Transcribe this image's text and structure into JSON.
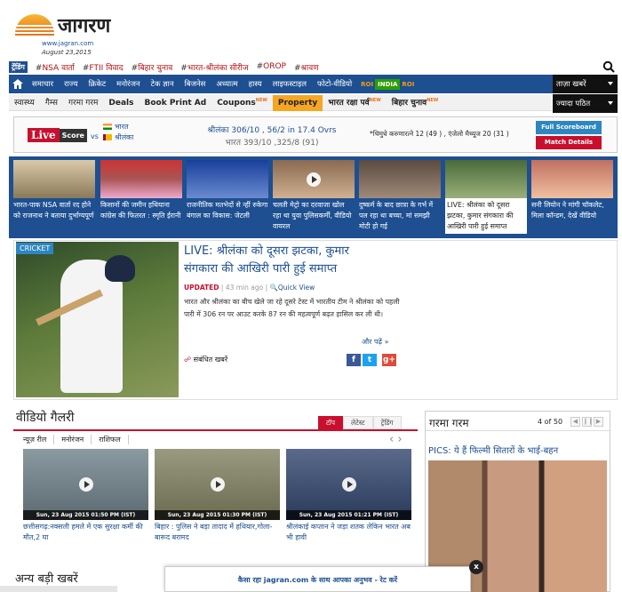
{
  "header": {
    "logo_text": "जागरण",
    "site_url": "www.jagran.com",
    "date": "August 23,2015"
  },
  "trending": {
    "tag": "ट्रेंडिंग",
    "items": [
      "NSA वार्ता",
      "FTII विवाद",
      "बिहार चुनाव",
      "भारत-श्रीलंका सीरीज",
      "OROP",
      "श्रावण"
    ]
  },
  "mainnav": {
    "items": [
      "समाचार",
      "राज्य",
      "क्रिकेट",
      "मनोरंजन",
      "टेक ज्ञान",
      "बिजनेस",
      "अध्यात्म",
      "हास्य",
      "लाइफस्टाइल",
      "फोटो-वीडियो"
    ],
    "roi": [
      "ROI",
      "INDIA",
      "ROI"
    ],
    "dd1": "ताज़ा खबरें",
    "dd2": "ज्यादा पठित"
  },
  "subnav": {
    "items": [
      "स्वास्थ्य",
      "गैम्स",
      "गरमा गरम",
      "Deals",
      "Book Print Ad",
      "Coupons",
      "Property",
      "भारत रक्षा पर्व",
      "बिहार चुनाव"
    ],
    "new_label": "NEW"
  },
  "score": {
    "live": "Live",
    "score_label": "Score",
    "vs": "vs",
    "team1": "भारत",
    "team2": "श्रीलंका",
    "line1": "श्रीलंका 306/10 , 56/2 in 17.4 Ovrs",
    "line2": "भारत 393/10 ,325/8 (91)",
    "batsmen": "*थिमुधे करुणारत्ने 12 (49 ) ,  एंजेलो मैथ्यूज 20 (31 )",
    "full_scoreboard": "Full Scoreboard",
    "match_details": "Match Details"
  },
  "strip": [
    {
      "caption": "भारत-पाक NSA वार्ता रद होने को राजनाथ ने बताया दुर्भाग्यपूर्ण",
      "video": false
    },
    {
      "caption": "किसानों की जमीन हथियाना कांग्रेस की फितरत : स्मृति ईरानी",
      "video": false
    },
    {
      "caption": "राजनीतिक मतभेदों से न्हीं रुकेगा बंगाल का विकास: जेटली",
      "video": false
    },
    {
      "caption": "चलती मेट्रो का दरवाजा खोल रहा था युवा पुलिसकर्मी, वीडियो वायरल",
      "video": true
    },
    {
      "caption": "दुष्कर्म के बाद छात्रा के गर्भ में पल रहा था बच्चा, मां समझी मोटी हो गई",
      "video": false
    },
    {
      "caption": "LIVE: श्रीलंका को दूसरा झटका, कुमार संगकारा की आखिरी पारी हुई समाप्त",
      "video": false
    },
    {
      "caption": "सनी लियोन ने मांगी चॉकलेट, मिला कॉन्डम, देखें वीडियो",
      "video": false
    }
  ],
  "featured": {
    "tag": "CRICKET",
    "title": "LIVE: श्रीलंका को दूसरा झटका, कुमार संगकारा की आखिरी पारी हुई समाप्त",
    "updated": "UPDATED",
    "ago": "43 min ago",
    "quickview": "Quick View",
    "body": "भारत और श्रीलंका का बीच खेले जा रहे दूसरे टेस्ट में भारतीय टीम ने श्रीलंका को पहली पारी में 306 रन पर आउट करके 87 रन की महत्वपूर्ण बढ़त हासिल कर ली थी।",
    "more": "और पढ़ें »",
    "related": "संबंधित खबरें",
    "share": [
      "f",
      "t",
      "g+"
    ]
  },
  "videos": {
    "heading": "वीडियो गैलरी",
    "tabs": [
      "टॉप",
      "लेटेस्ट",
      "ट्रेंडिंग"
    ],
    "subtabs": [
      "न्यूज़ रील",
      "मनोरंजन",
      "राशिफल"
    ],
    "items": [
      {
        "date": "Sun, 23 Aug 2015 01:50 PM (IST)",
        "caption": "छत्तीसगढ़:नक्सली हमले में एक सुरक्षा कर्मी की मौत,2 घा"
      },
      {
        "date": "Sun, 23 Aug 2015 01:30 PM (IST)",
        "caption": "बिहार : पुलिस ने बड़ा तादाद में हथियार,गोला-बारूद बरामद"
      },
      {
        "date": "Sun, 23 Aug 2015 01:21 PM (IST)",
        "caption": "श्रीलंकाई कप्तान ने जड़ा शतक लेकिन भारत अब भी हावी"
      }
    ]
  },
  "gallery": {
    "title": "गरमा गरम",
    "count": "4 of 50",
    "caption": "PICS: ये हैं फिल्मी सितारों के भाई-बहन"
  },
  "other_news": "अन्य बड़ी खबरें",
  "feedback": "कैसा रहा jagran.com के साथ आपका अनुभव - रेट करें",
  "feedback_close": "x"
}
